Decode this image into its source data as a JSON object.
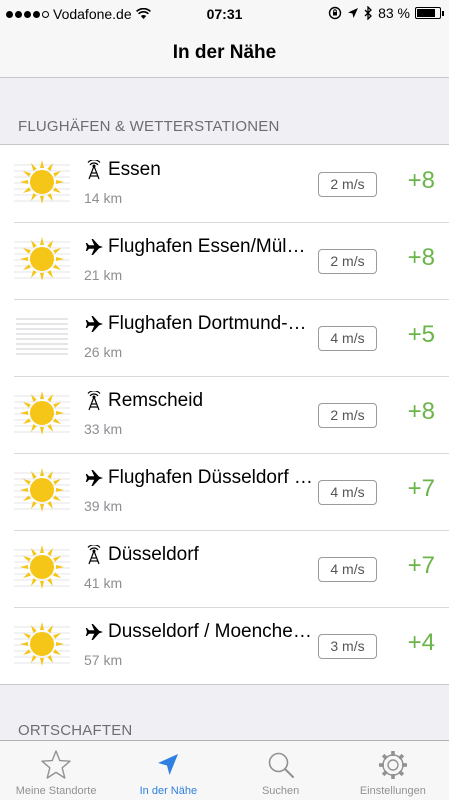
{
  "status_bar": {
    "carrier": "Vodafone.de",
    "time": "07:31",
    "battery": "83 %"
  },
  "nav": {
    "title": "In der Nähe"
  },
  "sections": {
    "airports_header": "FLUGHÄFEN & WETTERSTATIONEN",
    "places_header": "ORTSCHAFTEN"
  },
  "stations": [
    {
      "name": "Essen",
      "distance": "14 km",
      "wind": "2 m/s",
      "temp": "+8",
      "type": "station-antenna-icon",
      "weather": "sunny"
    },
    {
      "name": "Flughafen Essen/Mülheim",
      "distance": "21 km",
      "wind": "2 m/s",
      "temp": "+8",
      "type": "airplane-icon",
      "weather": "sunny"
    },
    {
      "name": "Flughafen Dortmund-Wickede",
      "distance": "26 km",
      "wind": "4 m/s",
      "temp": "+5",
      "type": "airplane-icon",
      "weather": "fog"
    },
    {
      "name": "Remscheid",
      "distance": "33 km",
      "wind": "2 m/s",
      "temp": "+8",
      "type": "station-antenna-icon",
      "weather": "sunny"
    },
    {
      "name": "Flughafen Düsseldorf International",
      "distance": "39 km",
      "wind": "4 m/s",
      "temp": "+7",
      "type": "airplane-icon",
      "weather": "sunny"
    },
    {
      "name": "Düsseldorf",
      "distance": "41 km",
      "wind": "4 m/s",
      "temp": "+7",
      "type": "station-antenna-icon",
      "weather": "sunny"
    },
    {
      "name": "Dusseldorf / Moenchengladbach",
      "distance": "57 km",
      "wind": "3 m/s",
      "temp": "+4",
      "type": "airplane-icon",
      "weather": "sunny"
    }
  ],
  "tabs": [
    {
      "label": "Meine Standorte",
      "icon": "star-icon"
    },
    {
      "label": "In der Nähe",
      "icon": "location-arrow-icon",
      "active": true
    },
    {
      "label": "Suchen",
      "icon": "search-icon"
    },
    {
      "label": "Einstellungen",
      "icon": "gear-icon"
    }
  ],
  "colors": {
    "accent": "#2f80e0",
    "temperature": "#6ab54a",
    "sun": "#f5c518",
    "background": "#efeff4"
  }
}
